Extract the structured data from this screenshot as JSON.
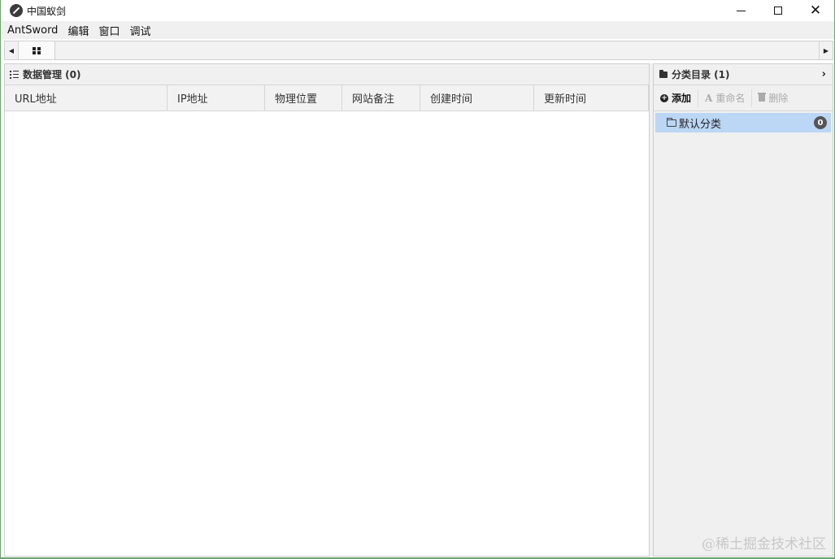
{
  "window": {
    "title": "中国蚁剑"
  },
  "menu": [
    "AntSword",
    "编辑",
    "窗口",
    "调试"
  ],
  "data_panel": {
    "title": "数据管理 (0)",
    "columns": [
      "URL地址",
      "IP地址",
      "物理位置",
      "网站备注",
      "创建时间",
      "更新时间"
    ]
  },
  "category_panel": {
    "title": "分类目录 (1)",
    "toolbar": {
      "add": "添加",
      "rename": "重命名",
      "delete": "删除"
    },
    "items": [
      {
        "label": "默认分类",
        "count": "0"
      }
    ]
  },
  "watermark": "@稀土掘金技术社区",
  "colors": {
    "selected_row": "#bcd6f5",
    "border_accent": "#6aa36a"
  }
}
